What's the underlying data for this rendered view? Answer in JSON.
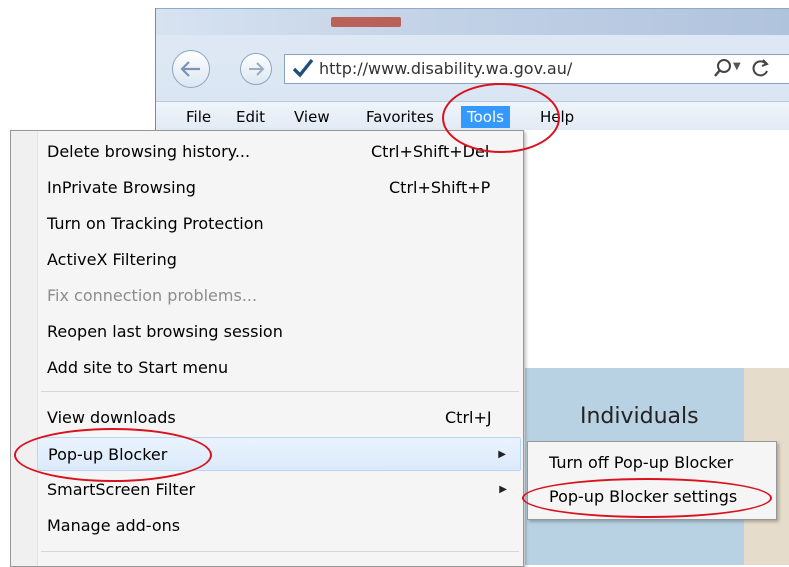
{
  "browser": {
    "url": "http://www.disability.wa.gov.au/",
    "menubar": [
      "File",
      "Edit",
      "View",
      "Favorites",
      "Tools",
      "Help"
    ],
    "active_menu": "Tools"
  },
  "tools_menu": {
    "items": [
      {
        "label": "Delete browsing history...",
        "shortcut": "Ctrl+Shift+Del"
      },
      {
        "label": "InPrivate Browsing",
        "shortcut": "Ctrl+Shift+P"
      },
      {
        "label": "Turn on Tracking Protection"
      },
      {
        "label": "ActiveX Filtering"
      },
      {
        "label": "Fix connection problems...",
        "disabled": true
      },
      {
        "label": "Reopen last browsing session"
      },
      {
        "label": "Add site to Start menu"
      },
      {
        "label": "View downloads",
        "shortcut": "Ctrl+J"
      },
      {
        "label": "Pop-up Blocker",
        "submenu": true,
        "highlighted": true
      },
      {
        "label": "SmartScreen Filter",
        "submenu": true
      },
      {
        "label": "Manage add-ons"
      }
    ]
  },
  "popup_submenu": {
    "items": [
      {
        "label": "Turn off Pop-up Blocker"
      },
      {
        "label": "Pop-up Blocker settings"
      }
    ]
  },
  "page": {
    "nav_label": "Individuals"
  },
  "annotation_color": "#d9121d"
}
